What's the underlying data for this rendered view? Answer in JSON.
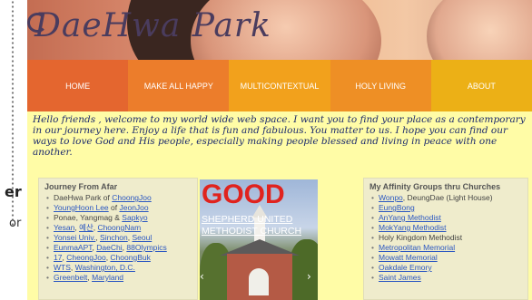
{
  "edge": {
    "fragment_top": "er",
    "fragment_bottom": "or"
  },
  "header": {
    "site_title": "DaeHwa Park"
  },
  "nav": {
    "items": [
      {
        "label": "HOME"
      },
      {
        "label": "MAKE ALL HAPPY"
      },
      {
        "label": "MULTICONTEXTUAL"
      },
      {
        "label": "HOLY LIVING"
      },
      {
        "label": "ABOUT"
      }
    ]
  },
  "intro": {
    "text": "Hello friends , welcome to my world wide web space.  I want you to find your place as a contemporary in our journey here.  Enjoy a life that is fun and fabulous. You matter to us.   I hope you can find our ways to love God and His people, especially making people blessed and living in peace with one another."
  },
  "left_column": {
    "title": "Journey From Afar",
    "items": [
      {
        "text": "DaeHwa Park of ",
        "link": "ChoongJoo"
      },
      {
        "text": "",
        "link": "YoungHoon Lee",
        "text2": " of ",
        "link2": "JeonJoo"
      },
      {
        "text": "Ponae, Yangmag & ",
        "link": "Sapkyo"
      },
      {
        "text": "",
        "link": "Yesan",
        "text2": ", ",
        "link2": "예산",
        "text3": ", ",
        "link3": "ChoongNam"
      },
      {
        "text": "",
        "link": "Yonsei Univ.",
        "text2": ", ",
        "link2": "Sinchon",
        "text3": ", ",
        "link3": "Seoul"
      },
      {
        "text": "",
        "link": "EunmaAPT",
        "text2": ", ",
        "link2": "DaeChi",
        "text3": ", ",
        "link3": "88Olympics"
      },
      {
        "text": "",
        "link": "17",
        "text2": ", ",
        "link2": "CheongJoo",
        "text3": ", ",
        "link3": "ChoongBuk"
      },
      {
        "text": "",
        "link": "WTS",
        "text2": ", ",
        "link2": "Washington, D.C."
      },
      {
        "text": "",
        "link": "Greenbelt",
        "text2": ", ",
        "link2": "Maryland"
      }
    ]
  },
  "church": {
    "headline": "GOOD",
    "name": "SHEPHERD UNITED METHODIST CHURCH",
    "prev_glyph": "‹",
    "next_glyph": "›"
  },
  "right_column": {
    "title": "My Affinity Groups thru Churches",
    "items": [
      {
        "link": "Wonpo",
        "text": ", DeungDae (Light House)"
      },
      {
        "link": "EungBong",
        "text": ""
      },
      {
        "link": "AnYang Methodist",
        "text": ""
      },
      {
        "link": "MokYang Methodist",
        "text": ""
      },
      {
        "link": "",
        "text": "Holy Kingdom Methodist"
      },
      {
        "link": "Metropolitan Memorial",
        "text": ""
      },
      {
        "link": "Mowatt Memorial",
        "text": ""
      },
      {
        "link": "Oakdale Emory",
        "text": ""
      },
      {
        "link": "Saint James",
        "text": ""
      }
    ]
  },
  "colors": {
    "page_bg": "#fffca6",
    "nav_home": "#e4662f",
    "nav_about": "#ecb016",
    "link": "#2b57c2",
    "headline_red": "#e0231e"
  }
}
